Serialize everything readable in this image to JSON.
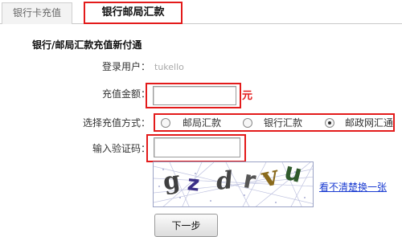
{
  "tabs": [
    {
      "label": "银行卡充值",
      "active": false
    },
    {
      "label": "银行邮局汇款",
      "active": true
    }
  ],
  "form": {
    "title": "银行/邮局汇款充值新付通",
    "login_user_label": "登录用户：",
    "login_user_value": "tukello",
    "amount_label": "充值金额：",
    "amount_value": "",
    "amount_unit": "元",
    "method_label": "选择充值方式：",
    "methods": [
      {
        "label": "邮局汇款",
        "selected": false
      },
      {
        "label": "银行汇款",
        "selected": false
      },
      {
        "label": "邮政网汇通",
        "selected": true
      }
    ],
    "captcha_label": "输入验证码：",
    "captcha_value": "",
    "captcha_text": [
      "g",
      "z",
      "d",
      "r",
      "v",
      "u"
    ],
    "refresh_link": "看不清楚换一张",
    "next_button": "下一步"
  },
  "colors": {
    "highlight": "#e31b1b",
    "link": "#1a3bd1",
    "captcha_border": "#9aa2c5"
  }
}
